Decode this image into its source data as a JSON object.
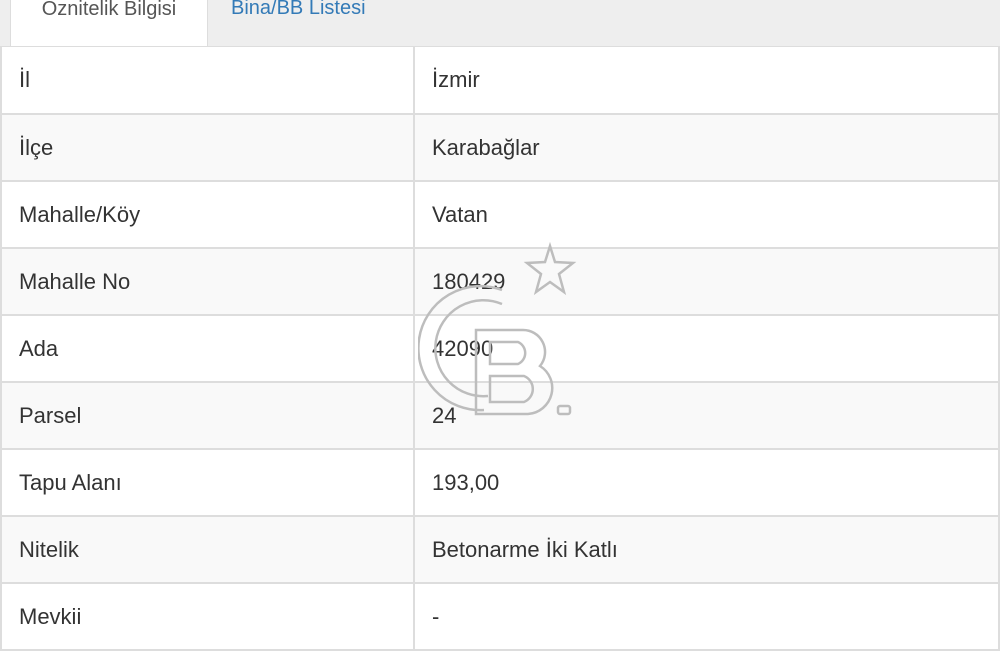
{
  "tabs": [
    {
      "label": "Öznitelik Bilgisi",
      "active": true
    },
    {
      "label": "Bina/BB Listesi",
      "active": false
    }
  ],
  "rows": [
    {
      "key": "İl",
      "value": "İzmir"
    },
    {
      "key": "İlçe",
      "value": "Karabağlar"
    },
    {
      "key": "Mahalle/Köy",
      "value": "Vatan"
    },
    {
      "key": "Mahalle No",
      "value": "180429"
    },
    {
      "key": "Ada",
      "value": "42090"
    },
    {
      "key": "Parsel",
      "value": "24"
    },
    {
      "key": "Tapu Alanı",
      "value": "193,00"
    },
    {
      "key": "Nitelik",
      "value": "Betonarme İki Katlı"
    },
    {
      "key": "Mevkii",
      "value": "-"
    }
  ],
  "watermark": {
    "icon": "cb-logo-star-icon",
    "color": "#bdbdbd"
  },
  "colors": {
    "link": "#337ab7",
    "border": "#dddddd",
    "stripe": "#f9f9f9"
  }
}
